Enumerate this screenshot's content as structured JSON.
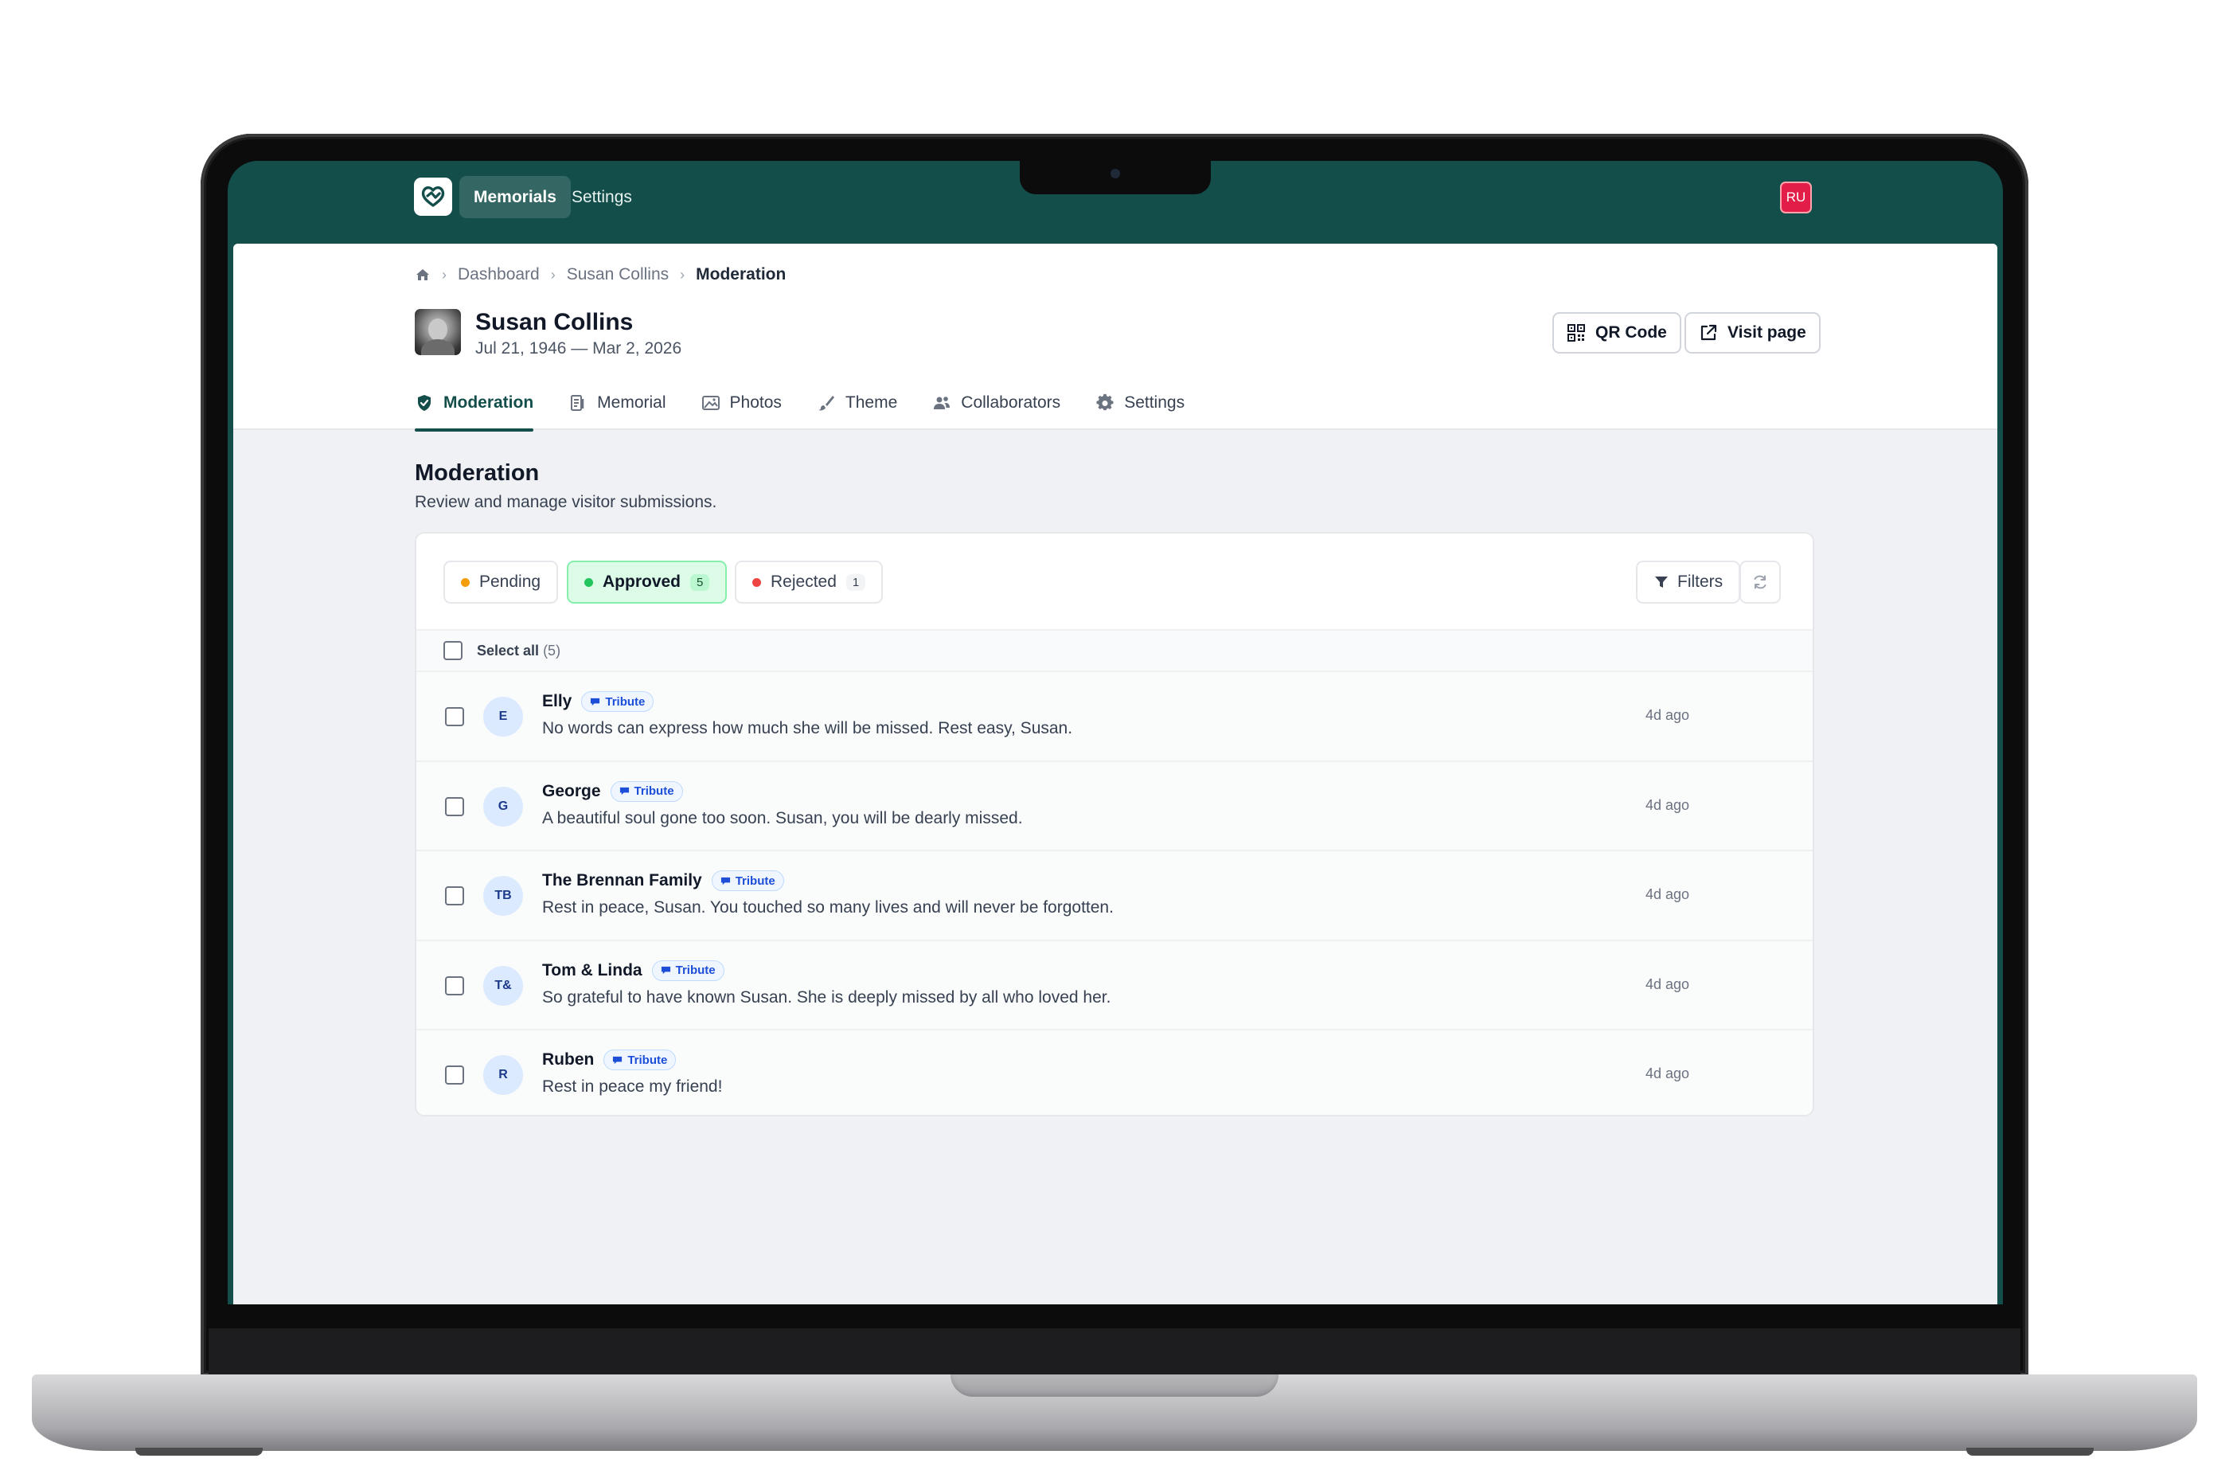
{
  "topnav": {
    "items": [
      {
        "label": "Memorials",
        "active": true
      },
      {
        "label": "Settings",
        "active": false
      }
    ],
    "user_initials": "RU",
    "brand_color": "#134e4a"
  },
  "breadcrumb": {
    "items": [
      "Dashboard",
      "Susan Collins"
    ],
    "current": "Moderation"
  },
  "memorial": {
    "name": "Susan Collins",
    "dates": "Jul 21, 1946 — Mar 2, 2026"
  },
  "actions": {
    "qr_label": "QR Code",
    "visit_label": "Visit page"
  },
  "tabs": [
    {
      "label": "Moderation",
      "icon": "shield-check-icon",
      "active": true
    },
    {
      "label": "Memorial",
      "icon": "document-icon",
      "active": false
    },
    {
      "label": "Photos",
      "icon": "image-icon",
      "active": false
    },
    {
      "label": "Theme",
      "icon": "brush-icon",
      "active": false
    },
    {
      "label": "Collaborators",
      "icon": "users-icon",
      "active": false
    },
    {
      "label": "Settings",
      "icon": "gear-icon",
      "active": false
    }
  ],
  "moderation": {
    "title": "Moderation",
    "subtitle": "Review and manage visitor submissions.",
    "filters": [
      {
        "label": "Pending",
        "count": "",
        "dot_color": "#f59e0b",
        "active": false
      },
      {
        "label": "Approved",
        "count": "5",
        "dot_color": "#22c55e",
        "active": true
      },
      {
        "label": "Rejected",
        "count": "1",
        "dot_color": "#ef4444",
        "active": false
      }
    ],
    "filters_label": "Filters",
    "select_all_label": "Select all",
    "select_all_count": "(5)",
    "submissions": [
      {
        "initials": "E",
        "author": "Elly",
        "type": "Tribute",
        "message": "No words can express how much she will be missed. Rest easy, Susan.",
        "time": "4d ago"
      },
      {
        "initials": "G",
        "author": "George",
        "type": "Tribute",
        "message": "A beautiful soul gone too soon. Susan, you will be dearly missed.",
        "time": "4d ago"
      },
      {
        "initials": "TB",
        "author": "The Brennan Family",
        "type": "Tribute",
        "message": "Rest in peace, Susan. You touched so many lives and will never be forgotten.",
        "time": "4d ago"
      },
      {
        "initials": "T&",
        "author": "Tom & Linda",
        "type": "Tribute",
        "message": "So grateful to have known Susan. She is deeply missed by all who loved her.",
        "time": "4d ago"
      },
      {
        "initials": "R",
        "author": "Ruben",
        "type": "Tribute",
        "message": "Rest in peace my friend!",
        "time": "4d ago"
      }
    ]
  }
}
